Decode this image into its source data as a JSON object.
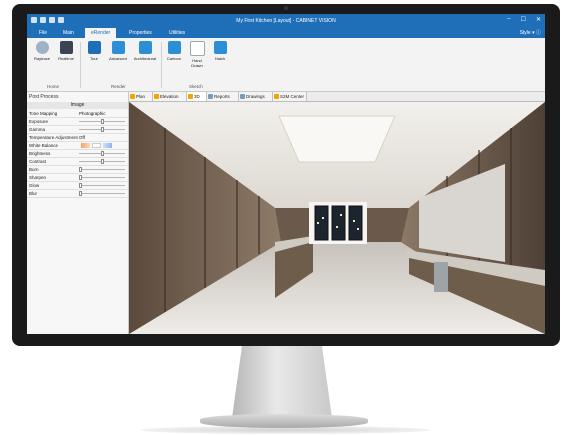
{
  "window": {
    "title": "My First Kitchen [Layout] - CABINET VISION"
  },
  "ribbon_tabs": [
    {
      "label": "File"
    },
    {
      "label": "Main"
    },
    {
      "label": "eRender"
    },
    {
      "label": "Properties"
    },
    {
      "label": "Utilities"
    }
  ],
  "style_menu": "Style",
  "ribbon": {
    "buttons": {
      "raytrace": "Raytrace",
      "realtime": "Realtime",
      "tour": "Tour",
      "advanced": "Advanced",
      "architectural": "Architectural",
      "cartoon": "Cartoon",
      "hand_drawn": "Hand Drawn",
      "hatch": "Hatch"
    },
    "groups": {
      "home": "Home",
      "render": "Render",
      "sketch": "Sketch"
    }
  },
  "panel": {
    "title": "Post Process",
    "section": "Image",
    "rows": {
      "tone_mapping": {
        "label": "Tone Mapping",
        "value": "Photographic"
      },
      "exposure": {
        "label": "Exposure"
      },
      "gamma": {
        "label": "Gamma"
      },
      "temp_adjust": {
        "label": "Temperature Adjustment",
        "value": "Off"
      },
      "white_balance": {
        "label": "White Balance"
      },
      "brightness": {
        "label": "Brightness"
      },
      "contrast": {
        "label": "Contrast"
      },
      "burn": {
        "label": "Burn"
      },
      "sharpen": {
        "label": "Sharpen"
      },
      "glow": {
        "label": "Glow"
      },
      "blur": {
        "label": "Blur"
      }
    }
  },
  "view_tabs": [
    {
      "label": "Plan"
    },
    {
      "label": "Elevation"
    },
    {
      "label": "3D"
    },
    {
      "label": "Reports"
    },
    {
      "label": "Drawings"
    },
    {
      "label": "S2M Center"
    }
  ],
  "colors": {
    "title_bar": "#1f6fb8",
    "active_tab_accent": "#f0a800"
  }
}
